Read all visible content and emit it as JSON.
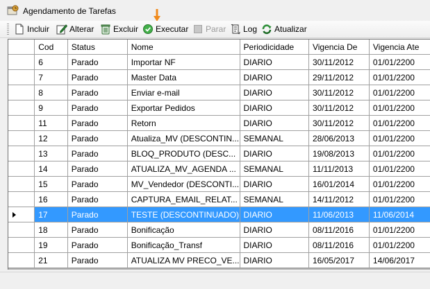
{
  "window": {
    "title": "Agendamento de Tarefas"
  },
  "toolbar": {
    "incluir": "Incluir",
    "alterar": "Alterar",
    "excluir": "Excluir",
    "executar": "Executar",
    "parar": "Parar",
    "log": "Log",
    "atualizar": "Atualizar"
  },
  "grid": {
    "headers": {
      "cod": "Cod",
      "status": "Status",
      "nome": "Nome",
      "periodicidade": "Periodicidade",
      "vigencia_de": "Vigencia De",
      "vigencia_ate": "Vigencia Ate"
    },
    "rows": [
      {
        "cod": "6",
        "status": "Parado",
        "nome": "Importar NF",
        "periodicidade": "DIARIO",
        "vigencia_de": "30/11/2012",
        "vigencia_ate": "01/01/2200"
      },
      {
        "cod": "7",
        "status": "Parado",
        "nome": "Master Data",
        "periodicidade": "DIARIO",
        "vigencia_de": "29/11/2012",
        "vigencia_ate": "01/01/2200"
      },
      {
        "cod": "8",
        "status": "Parado",
        "nome": "Enviar e-mail",
        "periodicidade": "DIARIO",
        "vigencia_de": "30/11/2012",
        "vigencia_ate": "01/01/2200"
      },
      {
        "cod": "9",
        "status": "Parado",
        "nome": "Exportar Pedidos",
        "periodicidade": "DIARIO",
        "vigencia_de": "30/11/2012",
        "vigencia_ate": "01/01/2200"
      },
      {
        "cod": "11",
        "status": "Parado",
        "nome": "Retorn",
        "periodicidade": "DIARIO",
        "vigencia_de": "30/11/2012",
        "vigencia_ate": "01/01/2200"
      },
      {
        "cod": "12",
        "status": "Parado",
        "nome": "Atualiza_MV  (DESCONTIN...",
        "periodicidade": "SEMANAL",
        "vigencia_de": "28/06/2013",
        "vigencia_ate": "01/01/2200"
      },
      {
        "cod": "13",
        "status": "Parado",
        "nome": "BLOQ_PRODUTO  (DESC...",
        "periodicidade": "DIARIO",
        "vigencia_de": "19/08/2013",
        "vigencia_ate": "01/01/2200"
      },
      {
        "cod": "14",
        "status": "Parado",
        "nome": "ATUALIZA_MV_AGENDA ...",
        "periodicidade": "SEMANAL",
        "vigencia_de": "11/11/2013",
        "vigencia_ate": "01/01/2200"
      },
      {
        "cod": "15",
        "status": "Parado",
        "nome": "MV_Vendedor (DESCONTI...",
        "periodicidade": "DIARIO",
        "vigencia_de": "16/01/2014",
        "vigencia_ate": "01/01/2200"
      },
      {
        "cod": "16",
        "status": "Parado",
        "nome": "CAPTURA_EMAIL_RELAT...",
        "periodicidade": "SEMANAL",
        "vigencia_de": "14/11/2012",
        "vigencia_ate": "01/01/2200"
      },
      {
        "cod": "17",
        "status": "Parado",
        "nome": "TESTE (DESCONTINUADO)",
        "periodicidade": "DIARIO",
        "vigencia_de": "11/06/2013",
        "vigencia_ate": "11/06/2014",
        "selected": true
      },
      {
        "cod": "18",
        "status": "Parado",
        "nome": "Bonificação",
        "periodicidade": "DIARIO",
        "vigencia_de": "08/11/2016",
        "vigencia_ate": "01/01/2200"
      },
      {
        "cod": "19",
        "status": "Parado",
        "nome": "Bonificação_Transf",
        "periodicidade": "DIARIO",
        "vigencia_de": "08/11/2016",
        "vigencia_ate": "01/01/2200"
      },
      {
        "cod": "21",
        "status": "Parado",
        "nome": "ATUALIZA MV PRECO_VE...",
        "periodicidade": "DIARIO",
        "vigencia_de": "16/05/2017",
        "vigencia_ate": "14/06/2017"
      }
    ]
  },
  "colors": {
    "selection": "#3399ff",
    "cursor_arrow": "#f08a1c"
  }
}
